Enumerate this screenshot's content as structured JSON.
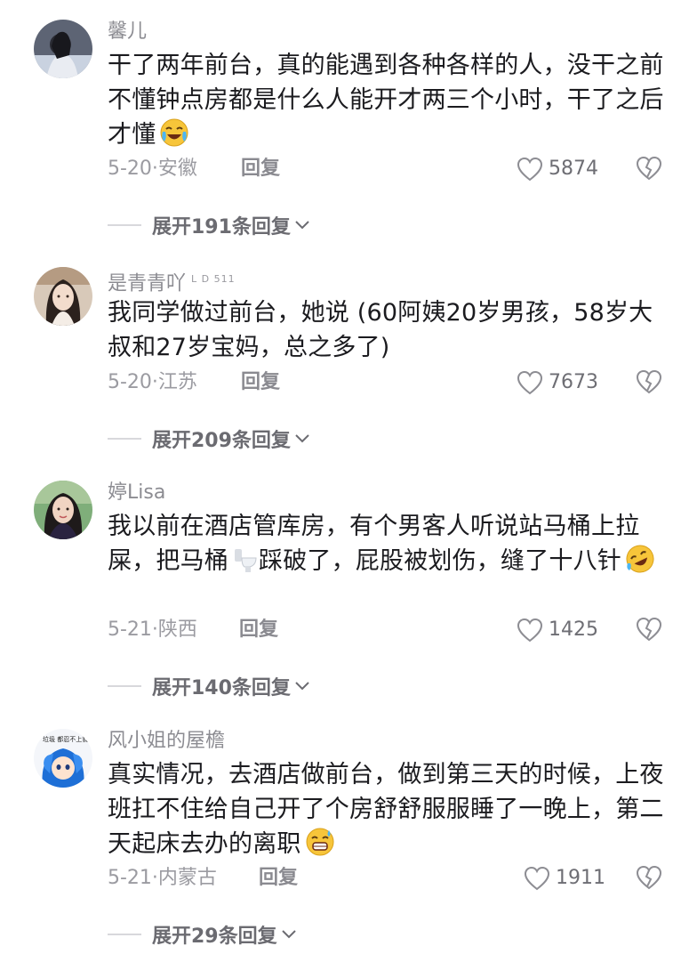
{
  "comments": [
    {
      "username": "馨儿",
      "level": "",
      "text": "干了两年前台，真的能遇到各种各样的人，没干之前不懂钟点房都是什么人能开才两三个小时，干了之后才懂",
      "emoji": "crying-laughing-emoji",
      "date_location": "5-20·安徽",
      "reply_label": "回复",
      "likes": "5874",
      "expand_label": "展开191条回复"
    },
    {
      "username": "是青青吖",
      "level": "L D 511",
      "text": "我同学做过前台，她说 (60阿姨20岁男孩，58岁大叔和27岁宝妈，总之多了)",
      "emoji": "",
      "date_location": "5-20·江苏",
      "reply_label": "回复",
      "likes": "7673",
      "expand_label": "展开209条回复"
    },
    {
      "username": "婷Lisa",
      "level": "",
      "text": "我以前在酒店管库房，有个男客人听说站马桶上拉屎，把马桶",
      "text_after": "踩破了，屁股被划伤，缝了十八针",
      "emoji": "rolling-laughing-emoji",
      "inline_icon": "toilet-icon",
      "date_location": "5-21·陕西",
      "reply_label": "回复",
      "likes": "1425",
      "expand_label": "展开140条回复"
    },
    {
      "username": "风小姐的屋檐",
      "level": "",
      "text": "真实情况，去酒店做前台，做到第三天的时候，上夜班扛不住给自己开了个房舒舒服服睡了一晚上，第二天起床去办的离职",
      "emoji": "sweat-grin-emoji",
      "date_location": "5-21·内蒙古",
      "reply_label": "回复",
      "likes": "1911",
      "expand_label": "展开29条回复"
    }
  ],
  "avatar4_badge_text": "垃圾 都忍不上我",
  "colors": {
    "meta": "#9b9ba1",
    "text": "#1b1b1f",
    "username": "#8c8c92"
  }
}
